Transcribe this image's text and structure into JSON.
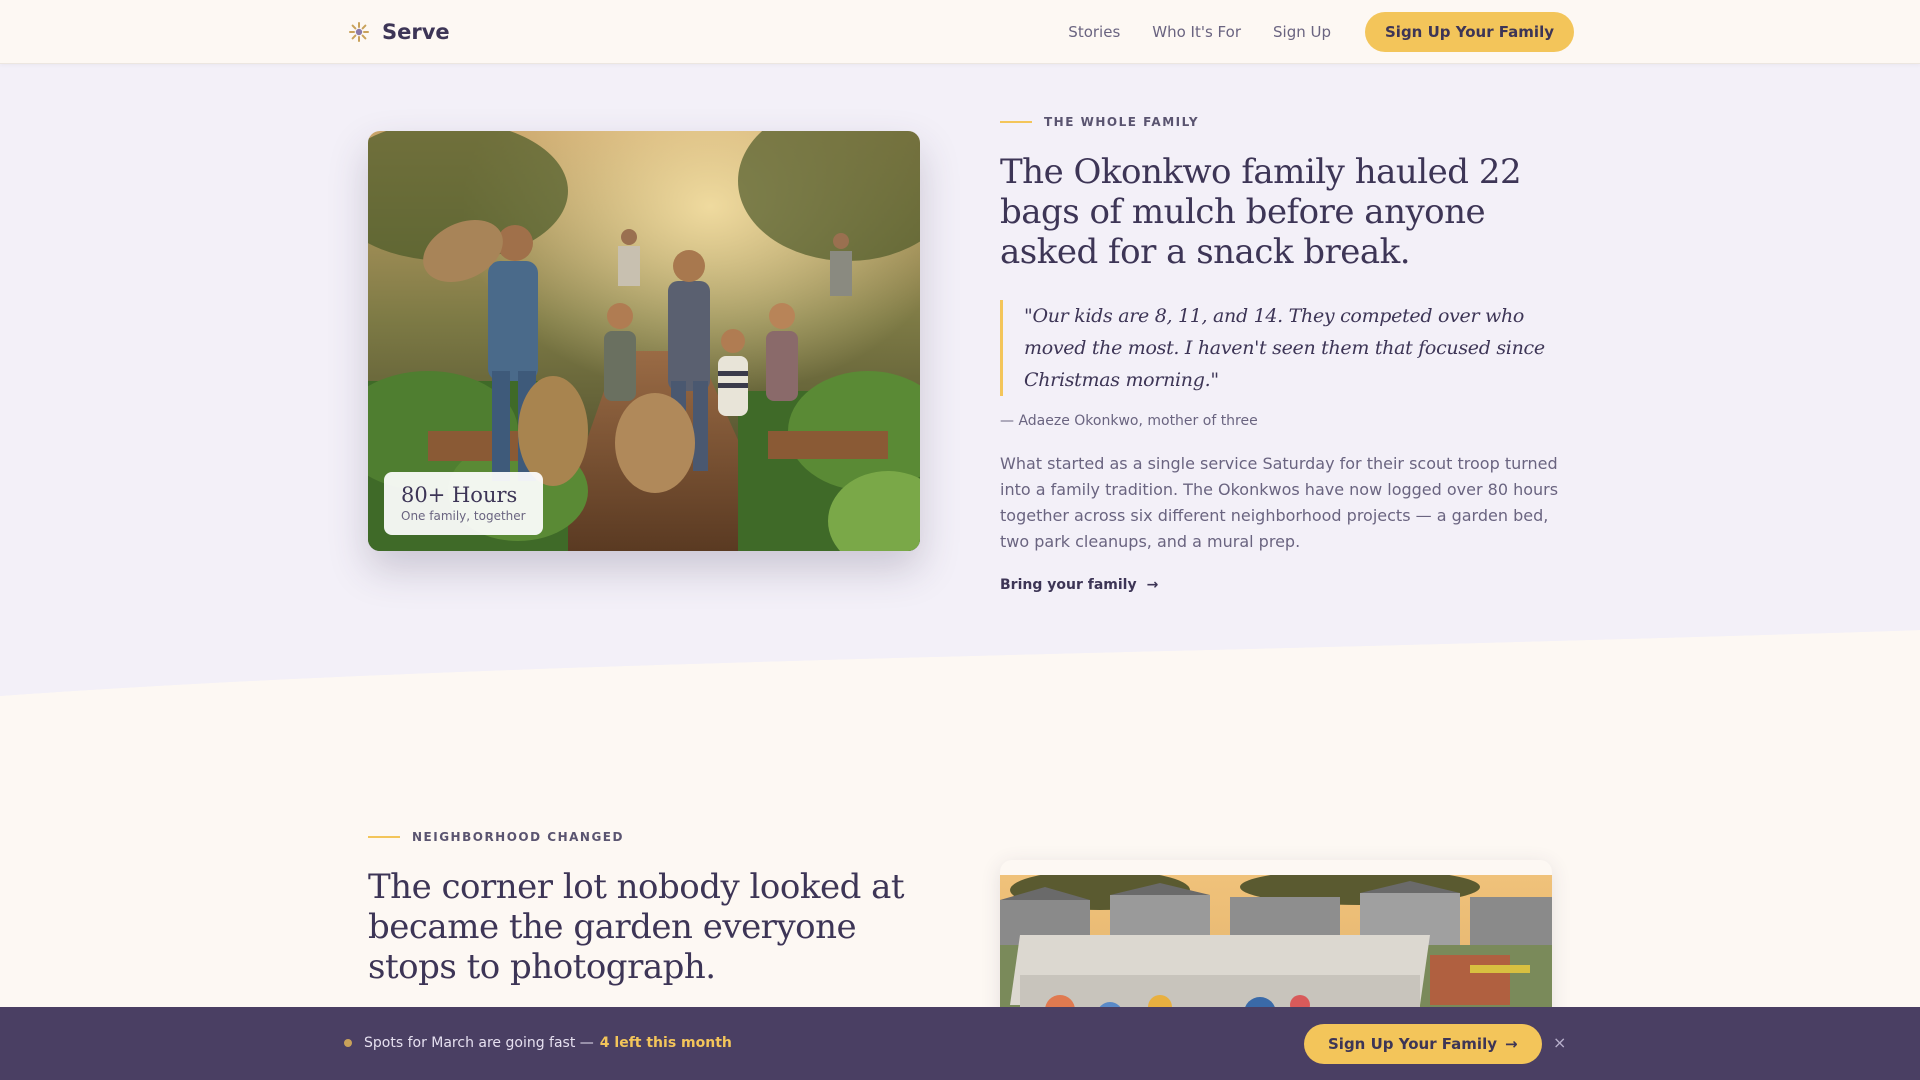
{
  "header": {
    "brand": "Serve",
    "nav": [
      "Stories",
      "Who It's For",
      "Sign Up"
    ],
    "cta": "Sign Up Your Family"
  },
  "story1": {
    "eyebrow": "THE WHOLE FAMILY",
    "headline": "The Okonkwo family hauled 22 bags of mulch before anyone asked for a snack break.",
    "quote": "\"Our kids are 8, 11, and 14. They competed over who moved the most. I haven't seen them that focused since Christmas morning.\"",
    "attribution": "— Adaeze Okonkwo, mother of three",
    "body": "What started as a single service Saturday for their scout troop turned into a family tradition. The Okonkwos have now logged over 80 hours together across six different neighborhood projects — a garden bed, two park cleanups, and a mural prep.",
    "link": "Bring your family",
    "link_arrow": "→",
    "stat_value": "80+ Hours",
    "stat_caption": "One family, together"
  },
  "story2": {
    "eyebrow": "NEIGHBORHOOD CHANGED",
    "headline": "The corner lot nobody looked at became the garden everyone stops to photograph."
  },
  "sticky_bar": {
    "message": "Spots for March are going fast —",
    "highlight": "4 left this month",
    "cta": "Sign Up Your Family",
    "cta_arrow": "→",
    "close": "×"
  },
  "colors": {
    "accent": "#f3c55a",
    "ink": "#3d3556",
    "muted": "#6a6480",
    "lavender_bg": "#f3f0f8",
    "cream_bg": "#fdf8f3",
    "bar_bg": "#4a3f63"
  },
  "icons": {
    "logo": "sunburst-logo-icon",
    "arrow": "arrow-right-icon",
    "close": "close-icon"
  }
}
